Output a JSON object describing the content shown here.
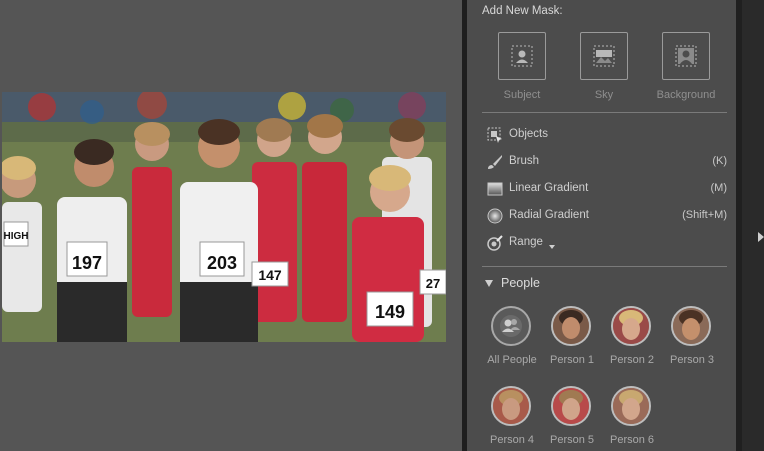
{
  "panel": {
    "title": "Add New Mask:",
    "mask_buttons": [
      {
        "label": "Subject",
        "icon": "subject-icon"
      },
      {
        "label": "Sky",
        "icon": "sky-icon"
      },
      {
        "label": "Background",
        "icon": "background-icon"
      }
    ],
    "tools": [
      {
        "label": "Objects",
        "shortcut": "",
        "icon": "objects-icon"
      },
      {
        "label": "Brush",
        "shortcut": "(K)",
        "icon": "brush-icon"
      },
      {
        "label": "Linear Gradient",
        "shortcut": "(M)",
        "icon": "linear-gradient-icon"
      },
      {
        "label": "Radial Gradient",
        "shortcut": "(Shift+M)",
        "icon": "radial-gradient-icon"
      },
      {
        "label": "Range",
        "shortcut": "",
        "icon": "range-icon"
      }
    ],
    "people": {
      "title": "People",
      "items": [
        {
          "label": "All People"
        },
        {
          "label": "Person 1"
        },
        {
          "label": "Person 2"
        },
        {
          "label": "Person 3"
        },
        {
          "label": "Person 4"
        },
        {
          "label": "Person 5"
        },
        {
          "label": "Person 6"
        }
      ]
    }
  },
  "photo": {
    "bib_numbers": [
      "197",
      "203",
      "147",
      "149",
      "27",
      "HIGH"
    ]
  }
}
